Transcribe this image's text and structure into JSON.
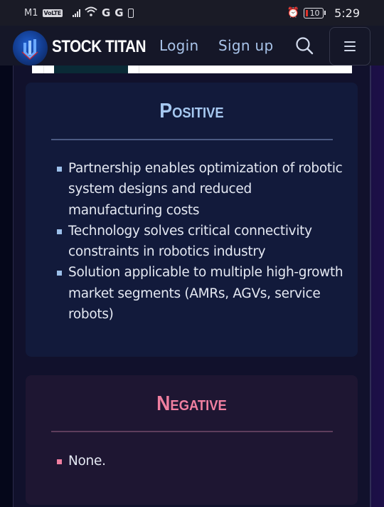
{
  "status_bar": {
    "carrier": "M1",
    "volte": "VoLTE",
    "battery_level": "10",
    "time": "5:29",
    "icons": [
      "signal-icon",
      "wifi-icon",
      "g-network-icon",
      "g-network-icon",
      "phone-battery-icon",
      "alarm-icon",
      "battery-icon"
    ]
  },
  "nav": {
    "brand": "STOCK TITAN",
    "login": "Login",
    "signup": "Sign up",
    "search_icon": "search-icon",
    "menu_icon": "hamburger-menu-icon"
  },
  "positive": {
    "title": "Positive",
    "accent": "#a6c8f0",
    "items": [
      "Partnership enables optimization of robotic system designs and reduced manufacturing costs",
      "Technology solves critical connectivity constraints in robotics industry",
      "Solution applicable to multiple high-growth market segments (AMRs, AGVs, service robots)"
    ]
  },
  "negative": {
    "title": "Negative",
    "accent": "#f07fa0",
    "items": [
      "None."
    ]
  }
}
